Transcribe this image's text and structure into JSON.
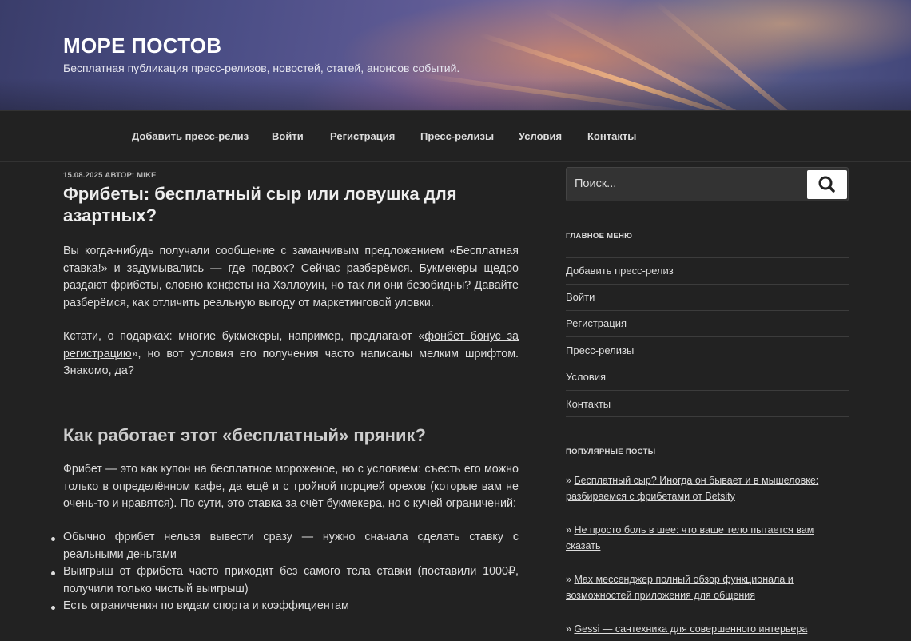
{
  "site": {
    "title": "МОРЕ ПОСТОВ",
    "description": "Бесплатная публикация пресс-релизов, новостей, статей, анонсов событий."
  },
  "nav": {
    "items": [
      {
        "label": "Добавить пресс-релиз"
      },
      {
        "label": "Войти"
      },
      {
        "label": "Регистрация"
      },
      {
        "label": "Пресс-релизы"
      },
      {
        "label": "Условия"
      },
      {
        "label": "Контакты"
      }
    ]
  },
  "post": {
    "meta": "15.08.2025 АВТОР: MIKE",
    "title": "Фрибеты: бесплатный сыр или ловушка для азартных?",
    "intro": "Вы когда-нибудь получали сообщение с заманчивым предложением «Бесплатная ставка!» и задумывались — где подвох? Сейчас разберёмся. Букмекеры щедро раздают фрибеты, словно конфеты на Хэллоуин, но так ли они безобидны? Давайте разберёмся, как отличить реальную выгоду от маркетинговой уловки.",
    "p2_before": "Кстати, о подарках: многие букмекеры, например, предлагают «",
    "p2_link": "фонбет бонус за регистрацию",
    "p2_after": "», но вот условия его получения часто написаны мелким шрифтом. Знакомо, да?",
    "h2": "Как работает этот «бесплатный» пряник?",
    "p3": "Фрибет — это как купон на бесплатное мороженое, но с условием: съесть его можно только в определённом кафе, да ещё и с тройной порцией орехов (которые вам не очень-то и нравятся). По сути, это ставка за счёт букмекера, но с кучей ограничений:",
    "list": [
      "Обычно фрибет нельзя вывести сразу — нужно сначала сделать ставку с реальными деньгами",
      "Выигрыш от фрибета часто приходит без самого тела ставки (поставили 1000₽, получили только чистый выигрыш)",
      "Есть ограничения по видам спорта и коэффициентам"
    ]
  },
  "sidebar": {
    "search_placeholder": "Поиск...",
    "search_icon": "search-icon",
    "main_menu_title": "ГЛАВНОЕ МЕНЮ",
    "main_menu": [
      {
        "label": "Добавить пресс-релиз"
      },
      {
        "label": "Войти"
      },
      {
        "label": "Регистрация"
      },
      {
        "label": "Пресс-релизы"
      },
      {
        "label": "Условия"
      },
      {
        "label": "Контакты"
      }
    ],
    "popular_title": "ПОПУЛЯРНЫЕ ПОСТЫ",
    "popular_prefix": "»",
    "popular": [
      {
        "label": "Бесплатный сыр? Иногда он бывает и в мышеловке: разбираемся с фрибетами от Betsity"
      },
      {
        "label": "Не просто боль в шее: что ваше тело пытается вам сказать"
      },
      {
        "label": "Max мессенджер полный обзор функционала и возможностей приложения для общения"
      },
      {
        "label": "Gessi — сантехника для совершенного интерьера"
      }
    ]
  },
  "colors": {
    "background": "#222222",
    "text": "#dddddd",
    "heading": "#eeeeee"
  }
}
